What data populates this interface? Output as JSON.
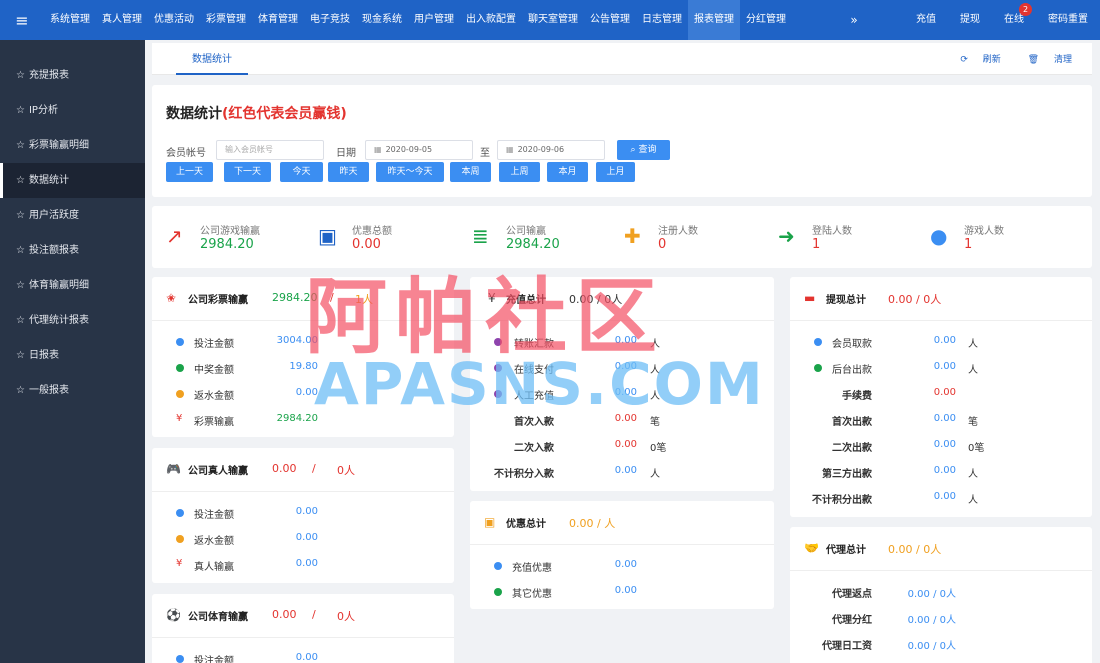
{
  "topnav": {
    "items": [
      "系统管理",
      "真人管理",
      "优惠活动",
      "彩票管理",
      "体育管理",
      "电子竞技",
      "现金系统",
      "用户管理",
      "出入款配置",
      "聊天室管理",
      "公告管理",
      "日志管理",
      "报表管理",
      "分红管理"
    ],
    "active": "报表管理",
    "more": "»",
    "actions": {
      "recharge": "充值",
      "withdraw": "提现",
      "online": "在线",
      "online_badge": "2",
      "reset_password": "密码重置"
    }
  },
  "sidebar": {
    "items": [
      "充提报表",
      "IP分析",
      "彩票输赢明细",
      "数据统计",
      "用户活跃度",
      "投注额报表",
      "体育输赢明细",
      "代理统计报表",
      "日报表",
      "一般报表"
    ],
    "active": "数据统计"
  },
  "tabs": {
    "active": "数据统计",
    "refresh": "刷新",
    "clear": "清理"
  },
  "filter": {
    "title": "数据统计",
    "title_note": "(红色代表会员赢钱)",
    "account_label": "会员帐号",
    "account_placeholder": "输入会员帐号",
    "date_label": "日期",
    "date_from": "2020-09-05",
    "to_label": "至",
    "date_to": "2020-09-06",
    "query": "查询",
    "quick": [
      "上一天",
      "下一天",
      "今天",
      "昨天",
      "昨天～今天",
      "本周",
      "上周",
      "本月",
      "上月"
    ]
  },
  "stats": [
    {
      "label": "公司游戏输赢",
      "value": "2984.20",
      "color": "green",
      "icon": "chart-line-icon"
    },
    {
      "label": "优惠总额",
      "value": "0.00",
      "color": "red",
      "icon": "money-bill-icon"
    },
    {
      "label": "公司输赢",
      "value": "2984.20",
      "color": "green",
      "icon": "coins-stack-icon"
    },
    {
      "label": "注册人数",
      "value": "0",
      "color": "red",
      "icon": "user-add-icon"
    },
    {
      "label": "登陆人数",
      "value": "1",
      "color": "red",
      "icon": "sign-in-icon"
    },
    {
      "label": "游戏人数",
      "value": "1",
      "color": "red",
      "icon": "user-icon"
    }
  ],
  "lottery": {
    "title": "公司彩票输赢",
    "value": "2984.20",
    "sep": "/",
    "people": "1人",
    "rows": [
      {
        "label": "投注金额",
        "value": "3004.00",
        "dot": "#3b8ef2",
        "vcolor": "blue"
      },
      {
        "label": "中奖金额",
        "value": "19.80",
        "dot": "#1aa34a",
        "vcolor": "blue"
      },
      {
        "label": "返水金额",
        "value": "0.00",
        "dot": "#f0a020",
        "vcolor": "blue"
      },
      {
        "label": "彩票输赢",
        "value": "2984.20",
        "yen": "¥",
        "vcolor": "green"
      }
    ]
  },
  "live": {
    "title": "公司真人输赢",
    "value": "0.00",
    "sep": "/",
    "people": "0人",
    "rows": [
      {
        "label": "投注金额",
        "value": "0.00",
        "dot": "#3b8ef2"
      },
      {
        "label": "返水金额",
        "value": "0.00",
        "dot": "#f0a020"
      },
      {
        "label": "真人输赢",
        "value": "0.00",
        "yen": "¥"
      }
    ]
  },
  "sports": {
    "title": "公司体育输赢",
    "value": "0.00",
    "sep": "/",
    "people": "0人",
    "rows": [
      {
        "label": "投注金额",
        "value": "0.00",
        "dot": "#3b8ef2"
      }
    ]
  },
  "deposit": {
    "title": "充值总计",
    "value": "0.00 / 0人",
    "rows": [
      {
        "label": "转账汇款",
        "value": "0.00",
        "unit": "人",
        "dot": "#8e44ad",
        "vcolor": "blue"
      },
      {
        "label": "在线支付",
        "value": "0.00",
        "unit": "人",
        "dot": "#8e44ad",
        "vcolor": "blue"
      },
      {
        "label": "人工充值",
        "value": "0.00",
        "unit": "人",
        "dot": "#8e44ad",
        "vcolor": "blue"
      },
      {
        "label": "首次入款",
        "value": "0.00",
        "unit": "笔",
        "vcolor": "red"
      },
      {
        "label": "二次入款",
        "value": "0.00",
        "unit": "0笔",
        "vcolor": "red"
      },
      {
        "label": "不计积分入款",
        "value": "0.00",
        "unit": "人",
        "vcolor": "blue"
      }
    ]
  },
  "promo": {
    "title": "优惠总计",
    "value": "0.00 / 人",
    "rows": [
      {
        "label": "充值优惠",
        "value": "0.00",
        "dot": "#3b8ef2"
      },
      {
        "label": "其它优惠",
        "value": "0.00",
        "dot": "#1aa34a"
      }
    ]
  },
  "withdraw": {
    "title": "提现总计",
    "value": "0.00 / 0人",
    "rows": [
      {
        "label": "会员取款",
        "value": "0.00",
        "unit": "人",
        "dot": "#3b8ef2",
        "vcolor": "blue"
      },
      {
        "label": "后台出款",
        "value": "0.00",
        "unit": "人",
        "dot": "#1aa34a",
        "vcolor": "blue"
      },
      {
        "label": "手续费",
        "value": "0.00",
        "unit": "",
        "vcolor": "red"
      },
      {
        "label": "首次出款",
        "value": "0.00",
        "unit": "笔",
        "vcolor": "blue"
      },
      {
        "label": "二次出款",
        "value": "0.00",
        "unit": "0笔",
        "vcolor": "blue"
      },
      {
        "label": "第三方出款",
        "value": "0.00",
        "unit": "人",
        "vcolor": "blue"
      },
      {
        "label": "不计积分出款",
        "value": "0.00",
        "unit": "人",
        "vcolor": "blue"
      }
    ]
  },
  "agent": {
    "title": "代理总计",
    "value": "0.00 / 0人",
    "rows": [
      {
        "label": "代理返点",
        "value": "0.00 / 0人"
      },
      {
        "label": "代理分红",
        "value": "0.00 / 0人"
      },
      {
        "label": "代理日工资",
        "value": "0.00 / 0人"
      }
    ]
  },
  "watermark": {
    "cn": "阿帕社区",
    "en": "APASNS.COM"
  }
}
